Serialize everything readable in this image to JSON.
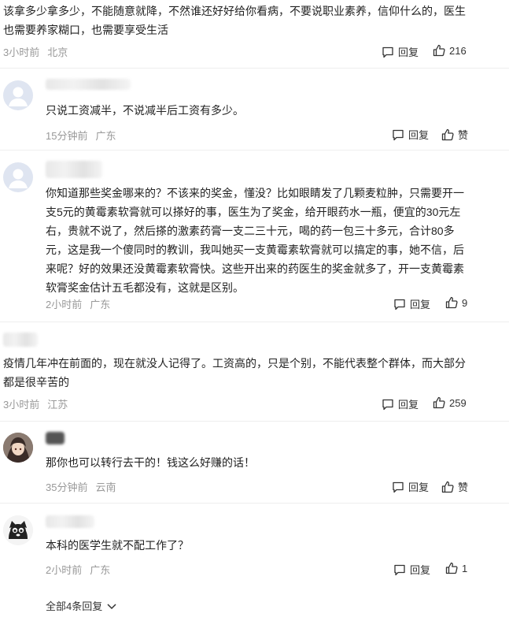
{
  "comments": [
    {
      "text": "该拿多少拿多少，不能随意就降，不然谁还好好给你看病，不要说职业素养，信仰什么的，医生也需要养家糊口，也需要享受生活",
      "time": "3小时前",
      "location": "北京",
      "reply_label": "回复",
      "likes": "216"
    },
    {
      "text": "只说工资减半，不说减半后工资有多少。",
      "time": "15分钟前",
      "location": "广东",
      "reply_label": "回复",
      "likes": "赞"
    },
    {
      "text": "你知道那些奖金哪来的？不该来的奖金，懂没？比如眼睛发了几颗麦粒肿，只需要开一支5元的黄霉素软膏就可以搽好的事，医生为了奖金，给开眼药水一瓶，便宜的30元左右，贵就不说了，然后搽的激素药膏一支二三十元，喝的药一包三十多元，合计80多元，这是我一个傻同时的教训，我叫她买一支黄霉素软膏就可以搞定的事，她不信，后来呢？好的效果还没黄霉素软膏快。这些开出来的药医生的奖金就多了，开一支黄霉素软膏奖金估计五毛都没有，这就是区别。",
      "time": "2小时前",
      "location": "广东",
      "reply_label": "回复",
      "likes": "9"
    },
    {
      "text": "疫情几年冲在前面的，现在就没人记得了。工资高的，只是个别，不能代表整个群体，而大部分都是很辛苦的",
      "time": "3小时前",
      "location": "江苏",
      "reply_label": "回复",
      "likes": "259"
    },
    {
      "text": "那你也可以转行去干的！钱这么好赚的话！",
      "time": "35分钟前",
      "location": "云南",
      "reply_label": "回复",
      "likes": "赞"
    },
    {
      "text": "本科的医学生就不配工作了？",
      "time": "2小时前",
      "location": "广东",
      "reply_label": "回复",
      "likes": "1"
    }
  ],
  "view_all_replies": "全部4条回复",
  "colors": {
    "text": "#222222",
    "meta": "#999999",
    "divider": "#eeeeee"
  }
}
